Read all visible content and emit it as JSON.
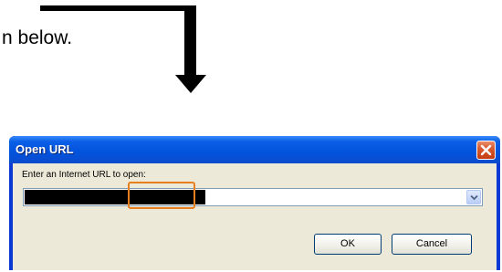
{
  "instruction": {
    "text": "n below."
  },
  "dialog": {
    "title": "Open URL",
    "prompt_label": "Enter an Internet URL to open:",
    "url_value": "",
    "buttons": {
      "ok_label": "OK",
      "cancel_label": "Cancel"
    },
    "icons": {
      "close": "close-icon",
      "dropdown": "chevron-down-icon"
    }
  },
  "colors": {
    "titlebar": "#0353dd",
    "client_bg": "#ece9d8",
    "close_button": "#d9572b",
    "highlight_outline": "#e87e1e",
    "arrow": "#000000"
  }
}
